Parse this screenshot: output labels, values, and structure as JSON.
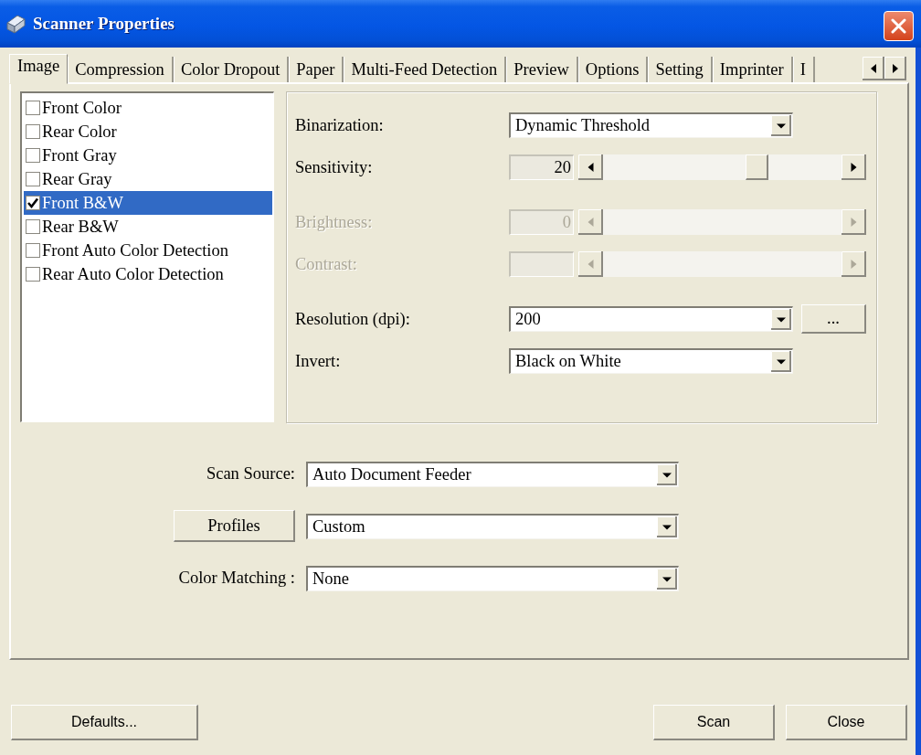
{
  "window": {
    "title": "Scanner Properties"
  },
  "tabs": [
    {
      "label": "Image",
      "selected": true
    },
    {
      "label": "Compression",
      "selected": false
    },
    {
      "label": "Color Dropout",
      "selected": false
    },
    {
      "label": "Paper",
      "selected": false
    },
    {
      "label": "Multi-Feed Detection",
      "selected": false
    },
    {
      "label": "Preview",
      "selected": false
    },
    {
      "label": "Options",
      "selected": false
    },
    {
      "label": "Setting",
      "selected": false
    },
    {
      "label": "Imprinter",
      "selected": false
    },
    {
      "label": "I",
      "selected": false
    }
  ],
  "image_types": [
    {
      "label": "Front Color",
      "checked": false,
      "selected": false
    },
    {
      "label": "Rear Color",
      "checked": false,
      "selected": false
    },
    {
      "label": "Front Gray",
      "checked": false,
      "selected": false
    },
    {
      "label": "Rear Gray",
      "checked": false,
      "selected": false
    },
    {
      "label": "Front B&W",
      "checked": true,
      "selected": true
    },
    {
      "label": "Rear B&W",
      "checked": false,
      "selected": false
    },
    {
      "label": "Front Auto Color Detection",
      "checked": false,
      "selected": false
    },
    {
      "label": "Rear Auto Color Detection",
      "checked": false,
      "selected": false
    }
  ],
  "settings": [
    {
      "rows": [
        {
          "kind": "dropdown",
          "label": "Binarization:",
          "value": "Dynamic Threshold"
        },
        {
          "kind": "slider",
          "label": "Sensitivity:",
          "value": "20",
          "level": 0.66,
          "disabled": false
        }
      ]
    },
    {
      "rows": [
        {
          "kind": "slider",
          "label": "Brightness:",
          "value": "0",
          "disabled": true
        },
        {
          "kind": "slider",
          "label": "Contrast:",
          "disabled": true
        }
      ]
    },
    {
      "rows": [
        {
          "kind": "dropdown",
          "label": "Resolution (dpi):",
          "value": "200",
          "button": "..."
        },
        {
          "kind": "dropdown",
          "label": "Invert:",
          "value": "Black on White"
        }
      ]
    }
  ],
  "source_rows": [
    {
      "kind": "label",
      "label": "Scan Source:",
      "value": "Auto Document Feeder"
    },
    {
      "kind": "button",
      "label": "Profiles",
      "value": "Custom"
    },
    {
      "kind": "label",
      "label": "Color Matching :",
      "value": "None"
    }
  ],
  "buttons": [
    "Defaults...",
    "Scan",
    "Close"
  ]
}
